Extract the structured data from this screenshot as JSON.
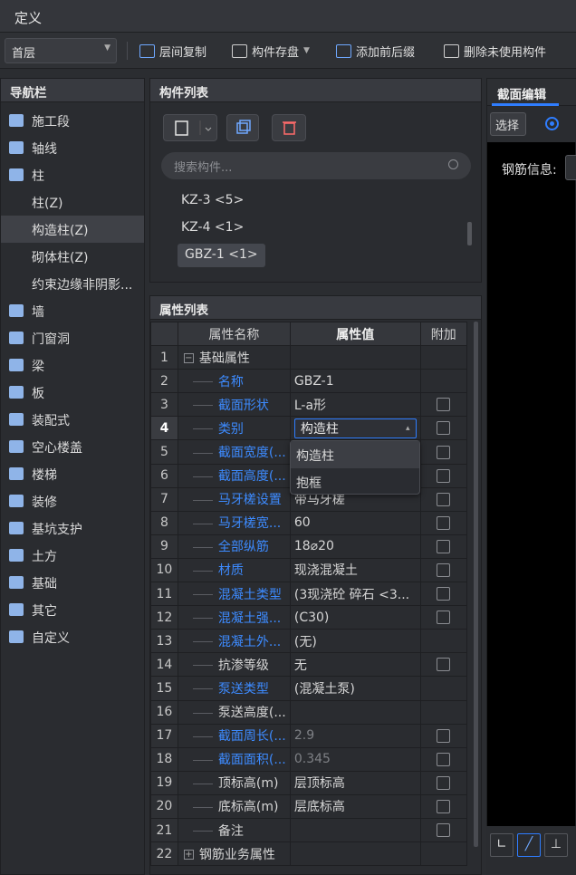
{
  "window": {
    "title": "定义"
  },
  "toolbar": {
    "floor": "首层",
    "copy_label": "层间复制",
    "save_label": "构件存盘",
    "prefix_label": "添加前后缀",
    "delete_label": "删除未使用构件"
  },
  "nav": {
    "title": "导航栏",
    "items": [
      {
        "label": "施工段",
        "icon": "construction-icon"
      },
      {
        "label": "轴线",
        "icon": "grid-icon"
      },
      {
        "label": "柱",
        "icon": "column-icon"
      },
      {
        "label": "柱(Z)"
      },
      {
        "label": "构造柱(Z)"
      },
      {
        "label": "砌体柱(Z)"
      },
      {
        "label": "约束边缘非阴影..."
      },
      {
        "label": "墙",
        "icon": "wall-icon"
      },
      {
        "label": "门窗洞",
        "icon": "door-icon"
      },
      {
        "label": "梁",
        "icon": "beam-icon"
      },
      {
        "label": "板",
        "icon": "slab-icon"
      },
      {
        "label": "装配式",
        "icon": "prefab-icon"
      },
      {
        "label": "空心楼盖",
        "icon": "hollow-floor-icon"
      },
      {
        "label": "楼梯",
        "icon": "stairs-icon"
      },
      {
        "label": "装修",
        "icon": "decoration-icon"
      },
      {
        "label": "基坑支护",
        "icon": "pit-support-icon"
      },
      {
        "label": "土方",
        "icon": "earthwork-icon"
      },
      {
        "label": "基础",
        "icon": "foundation-icon"
      },
      {
        "label": "其它",
        "icon": "other-icon"
      },
      {
        "label": "自定义",
        "icon": "custom-icon"
      }
    ]
  },
  "components": {
    "title": "构件列表",
    "search_placeholder": "搜索构件...",
    "items": [
      "KZ-3 <5>",
      "KZ-4 <1>",
      "GBZ-1 <1>"
    ]
  },
  "properties": {
    "title": "属性列表",
    "headers": [
      "属性名称",
      "属性值",
      "附加"
    ],
    "rows": [
      {
        "n": "1",
        "name": "基础属性",
        "value": "",
        "group": true
      },
      {
        "n": "2",
        "name": "名称",
        "value": "GBZ-1",
        "blue": true
      },
      {
        "n": "3",
        "name": "截面形状",
        "value": "L-a形",
        "blue": true,
        "cb": true
      },
      {
        "n": "4",
        "name": "类别",
        "value": "构造柱",
        "blue": true,
        "cb": true,
        "current": true
      },
      {
        "n": "5",
        "name": "截面宽度(...",
        "value": "",
        "blue": true,
        "cb": true
      },
      {
        "n": "6",
        "name": "截面高度(...",
        "value": "",
        "blue": true,
        "cb": true
      },
      {
        "n": "7",
        "name": "马牙槎设置",
        "value": "带马牙槎",
        "blue": true,
        "cb": true
      },
      {
        "n": "8",
        "name": "马牙槎宽...",
        "value": "60",
        "blue": true,
        "cb": true
      },
      {
        "n": "9",
        "name": "全部纵筋",
        "value": "18⌀20",
        "blue": true,
        "cb": true
      },
      {
        "n": "10",
        "name": "材质",
        "value": "现浇混凝土",
        "blue": true,
        "cb": true
      },
      {
        "n": "11",
        "name": "混凝土类型",
        "value": "(3现浇砼 碎石 <3...",
        "blue": true,
        "cb": true
      },
      {
        "n": "12",
        "name": "混凝土强...",
        "value": "(C30)",
        "blue": true,
        "cb": true
      },
      {
        "n": "13",
        "name": "混凝土外...",
        "value": "(无)",
        "blue": true
      },
      {
        "n": "14",
        "name": "抗渗等级",
        "value": "无",
        "cb": true
      },
      {
        "n": "15",
        "name": "泵送类型",
        "value": "(混凝土泵)",
        "blue": true
      },
      {
        "n": "16",
        "name": "泵送高度(...",
        "value": ""
      },
      {
        "n": "17",
        "name": "截面周长(...",
        "value": "2.9",
        "blue": true,
        "grayval": true,
        "cb": true
      },
      {
        "n": "18",
        "name": "截面面积(...",
        "value": "0.345",
        "blue": true,
        "grayval": true,
        "cb": true
      },
      {
        "n": "19",
        "name": "顶标高(m)",
        "value": "层顶标高",
        "cb": true
      },
      {
        "n": "20",
        "name": "底标高(m)",
        "value": "层底标高",
        "cb": true
      },
      {
        "n": "21",
        "name": "备注",
        "value": "",
        "cb": true
      },
      {
        "n": "22",
        "name": "钢筋业务属性",
        "value": "",
        "group": true,
        "collapsed": true
      }
    ],
    "dropdown_options": [
      "构造柱",
      "抱框"
    ]
  },
  "section": {
    "title": "截面编辑",
    "select_label": "选择",
    "rebar_label": "钢筋信息:"
  }
}
